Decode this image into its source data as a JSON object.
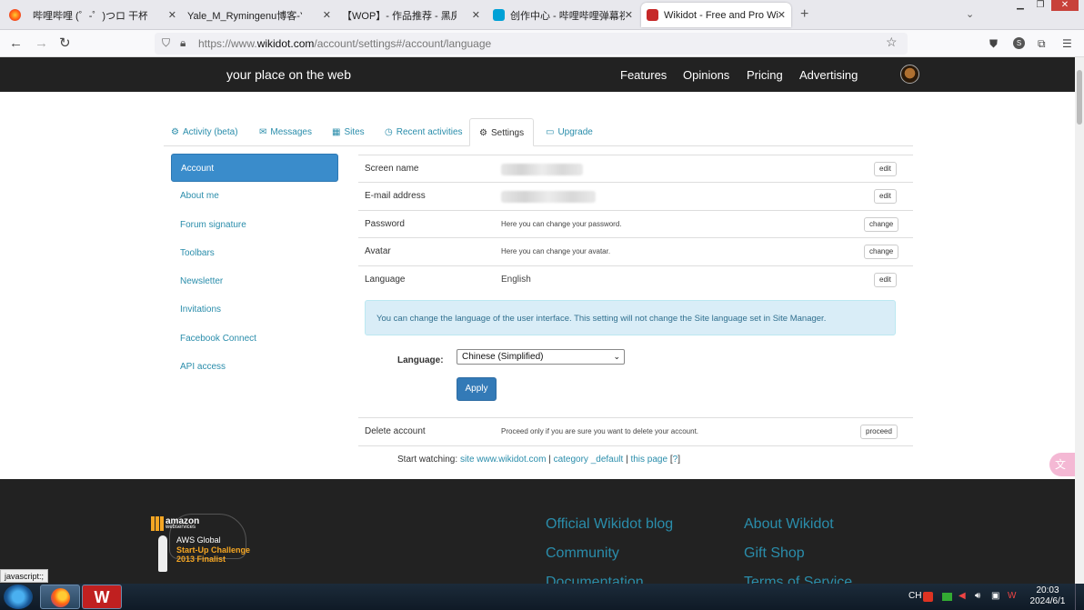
{
  "browser": {
    "tabs": [
      {
        "title": "哔哩哔哩 (゜-゜)つロ 干杯~-bilibili",
        "color": "#fb7299"
      },
      {
        "title": "Yale_M_Rymingenu博客-Yale_M_R",
        "color": "#888888"
      },
      {
        "title": "【WOP】- 作品推荐 - 黑房子 - 哔哩",
        "color": "#888888"
      },
      {
        "title": "创作中心 - 哔哩哔哩弹幕视频网",
        "color": "#00a1d6"
      },
      {
        "title": "Wikidot - Free and Pro Wiki Hos",
        "color": "#c62828"
      }
    ],
    "tab_close": "✕",
    "new_tab": "+",
    "url_prefix": "https://www.",
    "url_host": "wikidot.com",
    "url_path": "/account/settings#/account/language"
  },
  "site": {
    "tagline": "your place on the web",
    "nav": [
      "Features",
      "Opinions",
      "Pricing",
      "Advertising"
    ]
  },
  "tabs": [
    {
      "icon": "⚙",
      "label": "Activity (beta)"
    },
    {
      "icon": "✉",
      "label": "Messages"
    },
    {
      "icon": "▦",
      "label": "Sites"
    },
    {
      "icon": "◷",
      "label": "Recent activities"
    },
    {
      "icon": "⚙",
      "label": "Settings"
    },
    {
      "icon": "▭",
      "label": "Upgrade"
    }
  ],
  "sidebar": [
    "Account",
    "About me",
    "Forum signature",
    "Toolbars",
    "Newsletter",
    "Invitations",
    "Facebook Connect",
    "API access"
  ],
  "settings": {
    "screen_name": {
      "label": "Screen name",
      "button": "edit"
    },
    "email": {
      "label": "E-mail address",
      "button": "edit"
    },
    "password": {
      "label": "Password",
      "value": "Here you can change your password.",
      "button": "change"
    },
    "avatar": {
      "label": "Avatar",
      "value": "Here you can change your avatar.",
      "button": "change"
    },
    "language": {
      "label": "Language",
      "value": "English",
      "button": "edit"
    },
    "info": "You can change the language of the user interface. This setting will not change the Site language set in Site Manager.",
    "language_field_label": "Language:",
    "language_selected": "Chinese (Simplified)",
    "apply": "Apply",
    "delete": {
      "label": "Delete account",
      "value": "Proceed only if you are sure you want to delete your account.",
      "button": "proceed"
    }
  },
  "watching": {
    "prefix": "Start watching:",
    "site": "site www.wikidot.com",
    "sep": "|",
    "category": "category _default",
    "page": "this page",
    "help": "?"
  },
  "footer": {
    "links_left": [
      "Official Wikidot blog",
      "Community",
      "Documentation"
    ],
    "links_right": [
      "About Wikidot",
      "Gift Shop",
      "Terms of Service"
    ],
    "aws": {
      "line1": "amazon",
      "line2": "webservices",
      "line3": "AWS Global",
      "line4": "Start-Up Challenge",
      "line5": "2013 Finalist"
    }
  },
  "statusbar": "javascript:;",
  "taskbar": {
    "lang": "CH",
    "time": "20:03",
    "date": "2024/6/1"
  }
}
